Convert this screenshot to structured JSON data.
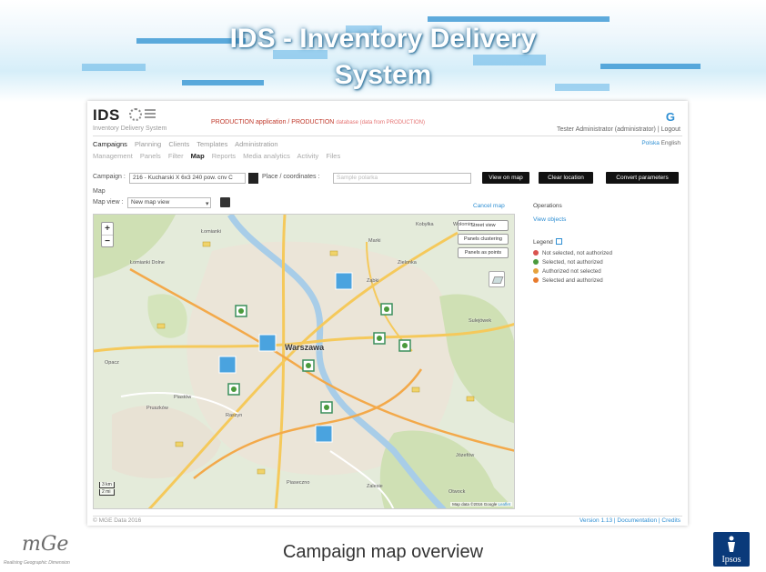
{
  "slide": {
    "title_line1": "IDS - Inventory Delivery",
    "title_line2": "System",
    "caption": "Campaign map overview",
    "mge_logo_text": "mGe",
    "mge_tagline": "Realising Geographic Dimension",
    "ipsos_logo_text": "Ipsos"
  },
  "app": {
    "logo": "IDS",
    "subtitle": "Inventory Delivery System",
    "environment": "PRODUCTION application / PRODUCTION",
    "environment_note": "database (data from PRODUCTION)",
    "user": "Tester Administrator (administrator) | Logout",
    "nav_primary": [
      "Campaigns",
      "Planning",
      "Clients",
      "Templates",
      "Administration"
    ],
    "nav_secondary": [
      "Management",
      "Panels",
      "Filter",
      "Map",
      "Reports",
      "Media analytics",
      "Activity",
      "Files"
    ],
    "language": {
      "polish": "Polska",
      "english": "English"
    },
    "filter": {
      "campaign_label": "Campaign :",
      "campaign_value": "216 - Kucharski X 6x3 240 pow. cnv C",
      "place_label": "Place / coordinates :",
      "place_placeholder": "Sample polarka",
      "view_on_map": "View on map",
      "clear_location": "Clear location",
      "convert_parameters": "Convert parameters"
    },
    "map_label": "Map",
    "map_view_label": "Map view :",
    "map_view_value": "New map view",
    "cancel_map": "Cancel map",
    "map": {
      "zoom_in": "+",
      "zoom_out": "−",
      "buttons": [
        "Street view",
        "Panels clustering",
        "Panels as points"
      ],
      "city": "Warszawa",
      "places": [
        "Łomianki",
        "Kobyłka",
        "Wołomin",
        "Marki",
        "Ząbki",
        "Zielonka",
        "Sulejówek",
        "Pruszków",
        "Piastów",
        "Opacz",
        "Łomianki Dolne",
        "Raszyn",
        "Józefów",
        "Otwock",
        "Piaseczno",
        "Zalesie"
      ],
      "scale_km": "3 km",
      "scale_mi": "2 mi",
      "attribution": "Map data ©2016 Google",
      "leaflet": "Leaflet"
    },
    "operations": {
      "title": "Operations",
      "view_objects": "View objects",
      "legend_title": "Legend",
      "legend": [
        {
          "label": "Not selected, not authorized",
          "color": "#d9534f"
        },
        {
          "label": "Selected, not authorized",
          "color": "#4a9a3c"
        },
        {
          "label": "Authorized not selected",
          "color": "#e6a23c"
        },
        {
          "label": "Selected and authorized",
          "color": "#e87a2c"
        }
      ]
    },
    "copyright": "© MGE Data 2016",
    "version": "Version 1.13  |  Documentation  |  Credits"
  },
  "colors": {
    "accent_blue": "#2f8fd3",
    "cluster_blue": "#4aa3df",
    "banner_blue": "#2a8fd0"
  },
  "icons": [
    "zoom-in-icon",
    "zoom-out-icon",
    "layers-icon",
    "filter-icon",
    "save-icon",
    "g-logo-icon",
    "chevron-down-icon"
  ]
}
